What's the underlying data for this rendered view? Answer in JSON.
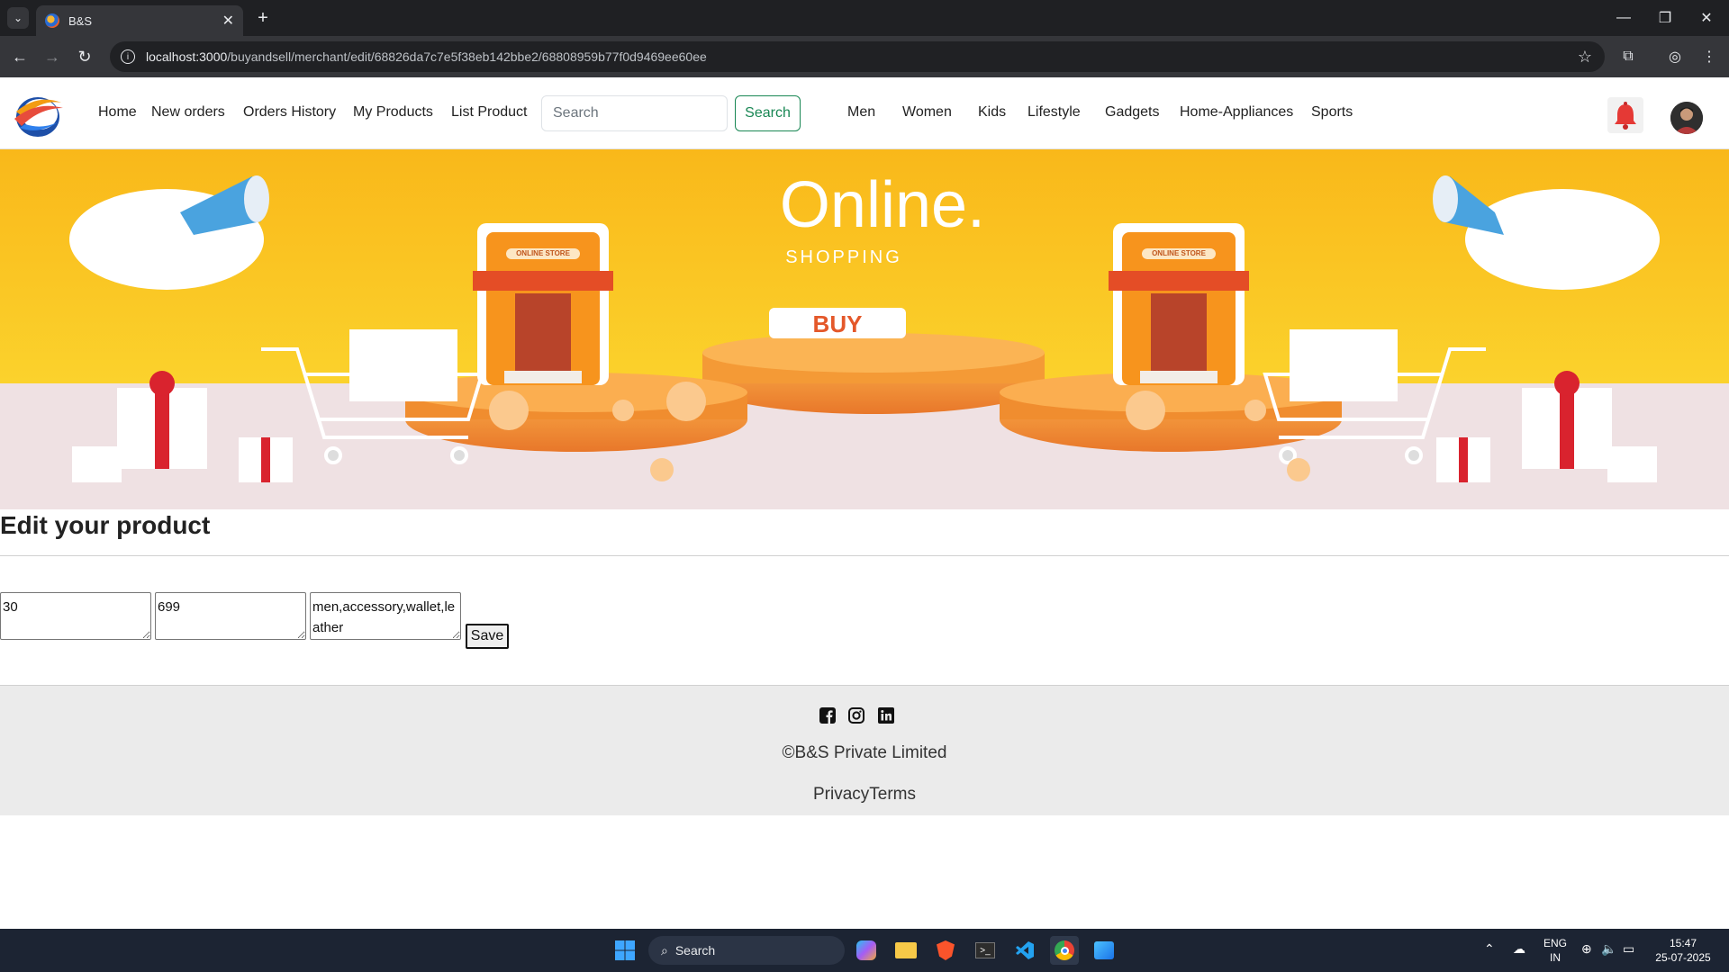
{
  "browser": {
    "tab_title": "B&S",
    "url_host": "localhost:3000",
    "url_path": "/buyandsell/merchant/edit/68826da7c7e5f38eb142bbe2/68808959b77f0d9469ee60ee"
  },
  "nav": {
    "home": "Home",
    "new_orders": "New orders",
    "orders_history": "Orders History",
    "my_products": "My Products",
    "list_product": "List Product",
    "search_placeholder": "Search",
    "search_button": "Search",
    "categories": [
      "Men",
      "Women",
      "Kids",
      "Lifestyle",
      "Gadgets",
      "Home-Appliances",
      "Sports"
    ]
  },
  "banner": {
    "headline": "Online.",
    "subhead": "SHOPPING",
    "cta": "BUY",
    "store_sign": "ONLINE STORE"
  },
  "page": {
    "title": "Edit your product",
    "field1_value": "30",
    "field2_value": "699",
    "field3_value": "men,accessory,wallet,leather",
    "save_label": "Save"
  },
  "footer": {
    "copyright": "©B&S Private Limited",
    "legal": "PrivacyTerms"
  },
  "taskbar": {
    "search_label": "Search",
    "lang_top": "ENG",
    "lang_bottom": "IN",
    "time": "15:47",
    "date": "25-07-2025"
  },
  "colors": {
    "banner_yellow": "#f9c21a",
    "search_green": "#198754",
    "footer_bg": "#ebebeb"
  }
}
